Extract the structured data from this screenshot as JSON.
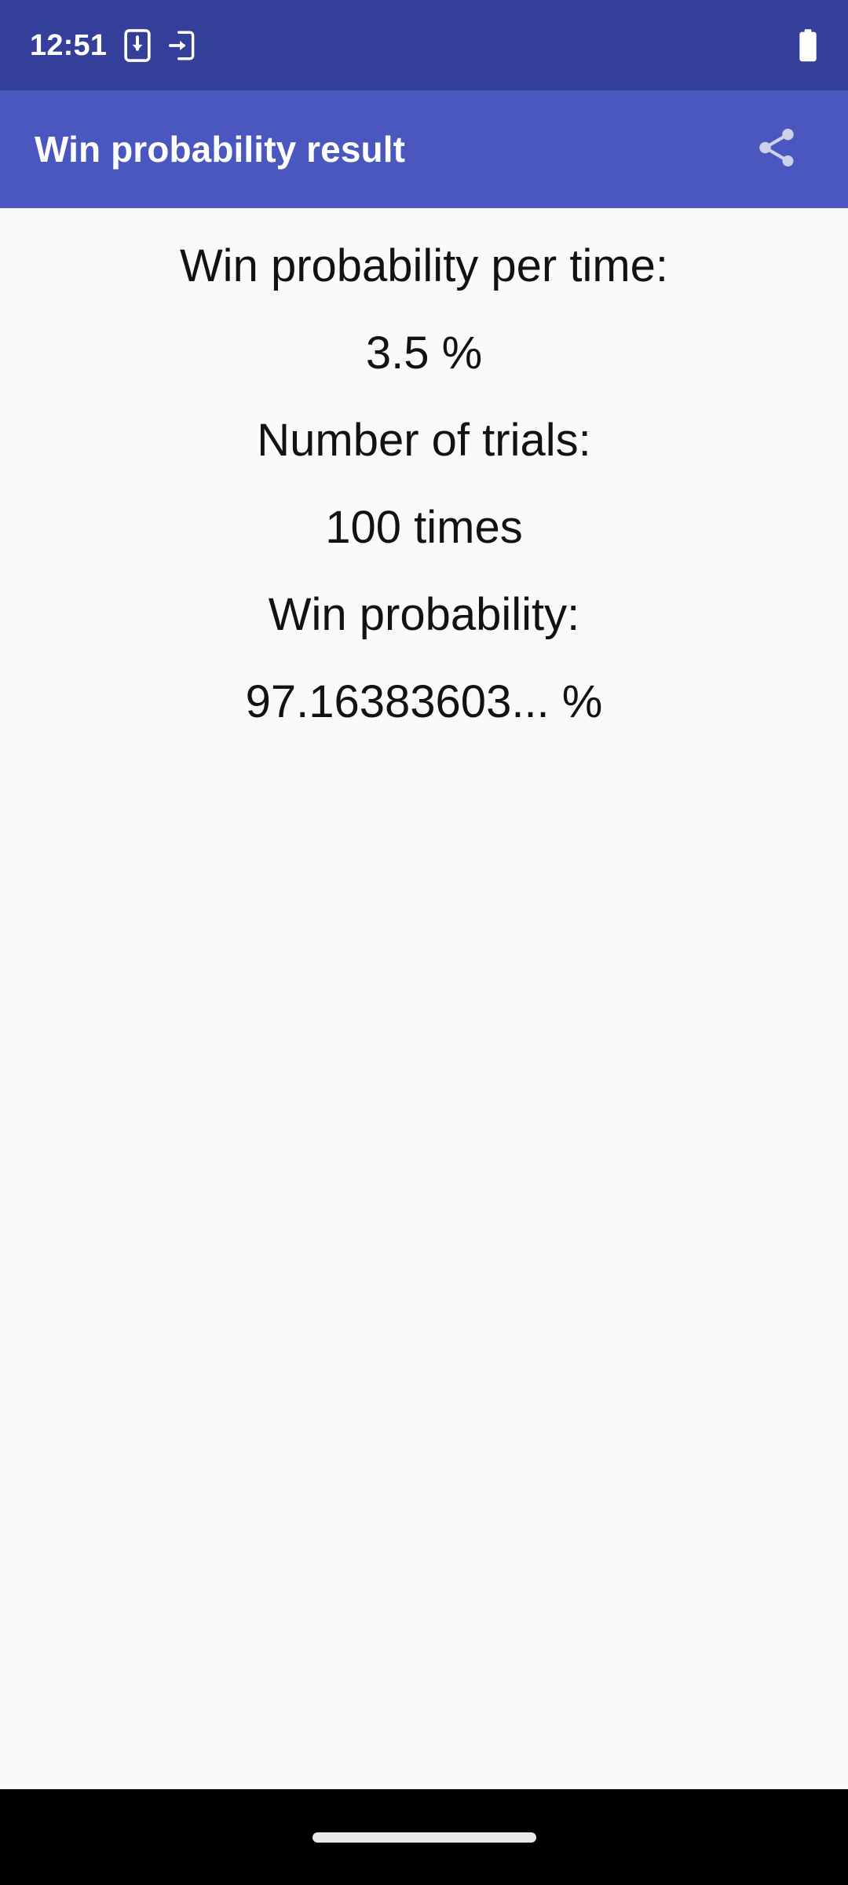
{
  "status_bar": {
    "clock": "12:51",
    "icons": [
      {
        "name": "system-update-icon",
        "glyph": "phone-down-arrow"
      },
      {
        "name": "app-install-icon",
        "glyph": "phone-right-arrow"
      }
    ],
    "battery": {
      "name": "battery-full-icon",
      "level_label": ""
    },
    "background_color": "#343F99",
    "foreground_color": "#FFFFFF"
  },
  "app_bar": {
    "title": "Win probability result",
    "share_label": "Share",
    "background_color": "#4A57BE",
    "title_color": "#FFFFFF"
  },
  "content": {
    "background_color": "#FAFAFA",
    "text_color": "#121212",
    "lines": [
      {
        "label": "Win probability per time:"
      },
      {
        "value": "3.5 %"
      },
      {
        "label": "Number of trials:"
      },
      {
        "value": "100 times"
      },
      {
        "label": "Win probability:"
      },
      {
        "value": "97.16383603... %"
      }
    ],
    "win_probability_per_time_label": "Win probability per time:",
    "win_probability_per_time_value": "3.5 %",
    "number_of_trials_label": "Number of trials:",
    "number_of_trials_value": "100 times",
    "win_probability_label": "Win probability:",
    "win_probability_value": "97.16383603... %"
  },
  "nav_bar": {
    "background_color": "#000000",
    "gesture_pill_color": "#E9E9E9"
  }
}
